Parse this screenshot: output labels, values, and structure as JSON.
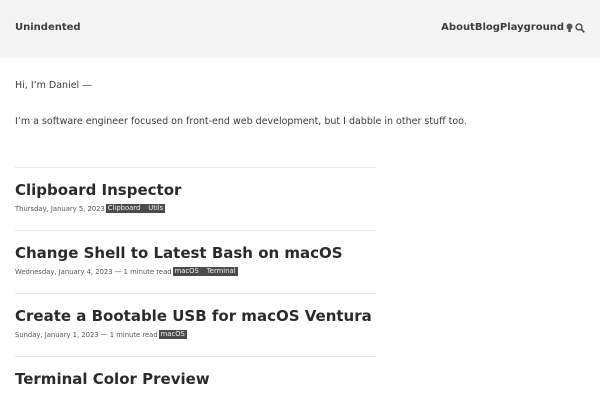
{
  "header": {
    "site_title": "Unindented",
    "nav": [
      "About",
      "Blog",
      "Playground"
    ],
    "icons": [
      "lightbulb-icon",
      "search-icon"
    ]
  },
  "intro": {
    "greeting": "Hi, I’m Daniel —",
    "bio": "I’m a software engineer focused on front-end web development, but I dabble in other stuff too."
  },
  "posts": [
    {
      "title": "Clipboard Inspector",
      "meta": "Thursday, January 5, 2023",
      "tags": [
        "Clipboard",
        "Utils"
      ]
    },
    {
      "title": "Change Shell to Latest Bash on macOS",
      "meta": "Wednesday, January 4, 2023 — 1 minute read",
      "tags": [
        "macOS",
        "Terminal"
      ]
    },
    {
      "title": "Create a Bootable USB for macOS Ventura",
      "meta": "Sunday, January 1, 2023 — 1 minute read",
      "tags": [
        "macOS"
      ]
    },
    {
      "title": "Terminal Color Preview",
      "meta": "",
      "tags": []
    }
  ]
}
